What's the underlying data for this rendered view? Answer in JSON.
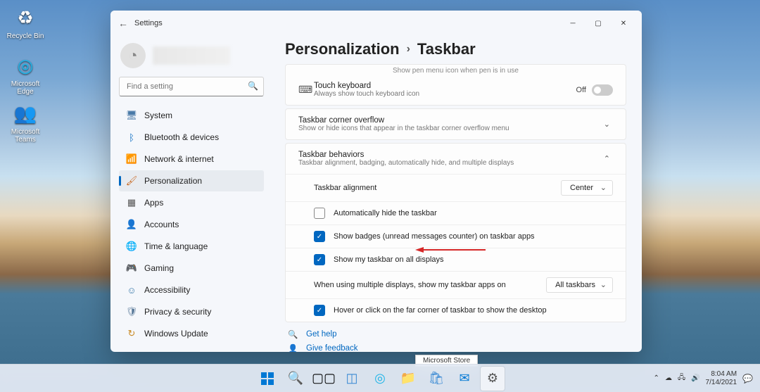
{
  "desktop": {
    "icons": [
      {
        "label": "Recycle Bin",
        "glyph": "♻"
      },
      {
        "label": "Microsoft Edge",
        "glyph": "◎"
      },
      {
        "label": "Microsoft Teams",
        "glyph": "👥"
      }
    ]
  },
  "window": {
    "title": "Settings",
    "search_placeholder": "Find a setting",
    "user_name": ""
  },
  "nav": [
    {
      "icon": "🖥",
      "label": "System",
      "name": "system"
    },
    {
      "icon": "ᛒ",
      "label": "Bluetooth & devices",
      "name": "bluetooth",
      "color": "#0067c0"
    },
    {
      "icon": "📶",
      "label": "Network & internet",
      "name": "network"
    },
    {
      "icon": "🖌",
      "label": "Personalization",
      "name": "personalization",
      "active": true
    },
    {
      "icon": "▦",
      "label": "Apps",
      "name": "apps"
    },
    {
      "icon": "👤",
      "label": "Accounts",
      "name": "accounts"
    },
    {
      "icon": "🌐",
      "label": "Time & language",
      "name": "time"
    },
    {
      "icon": "🎮",
      "label": "Gaming",
      "name": "gaming"
    },
    {
      "icon": "☺",
      "label": "Accessibility",
      "name": "accessibility"
    },
    {
      "icon": "🛡",
      "label": "Privacy & security",
      "name": "privacy"
    },
    {
      "icon": "↻",
      "label": "Windows Update",
      "name": "update"
    }
  ],
  "breadcrumb": {
    "p1": "Personalization",
    "p2": "Taskbar"
  },
  "truncated_line": "Show pen menu icon when pen is in use",
  "touch_kbd": {
    "title": "Touch keyboard",
    "sub": "Always show touch keyboard icon",
    "toggle": "Off"
  },
  "overflow": {
    "title": "Taskbar corner overflow",
    "sub": "Show or hide icons that appear in the taskbar corner overflow menu"
  },
  "behaviors": {
    "title": "Taskbar behaviors",
    "sub": "Taskbar alignment, badging, automatically hide, and multiple displays"
  },
  "alignment": {
    "label": "Taskbar alignment",
    "value": "Center"
  },
  "checks": {
    "autohide": "Automatically hide the taskbar",
    "badges": "Show badges (unread messages counter) on taskbar apps",
    "alldisplays": "Show my taskbar on all displays",
    "hover": "Hover or click on the far corner of taskbar to show the desktop"
  },
  "multi": {
    "label": "When using multiple displays, show my taskbar apps on",
    "value": "All taskbars"
  },
  "help": {
    "get": "Get help",
    "feedback": "Give feedback"
  },
  "tooltip": "Microsoft Store",
  "tray": {
    "time": "8:04 AM",
    "date": "7/14/2021"
  },
  "colors": {
    "accent": "#0067c0"
  }
}
